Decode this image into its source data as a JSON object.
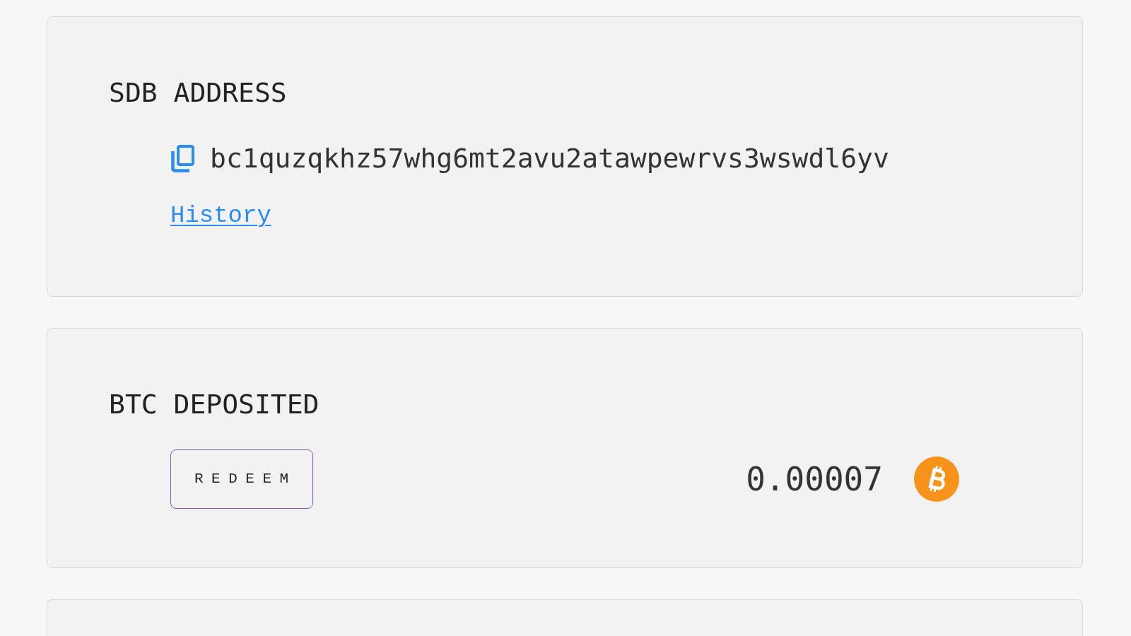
{
  "panels": [
    {
      "kind": "address",
      "title": "SDB ADDRESS",
      "address": "bc1quzqkhz57whg6mt2avu2atawpewrvs3wswdl6yv",
      "link": "History"
    },
    {
      "kind": "deposit",
      "title": "BTC DEPOSITED",
      "button": "REDEEM",
      "amount": "0.00007"
    },
    {
      "kind": "cut_off"
    }
  ]
}
